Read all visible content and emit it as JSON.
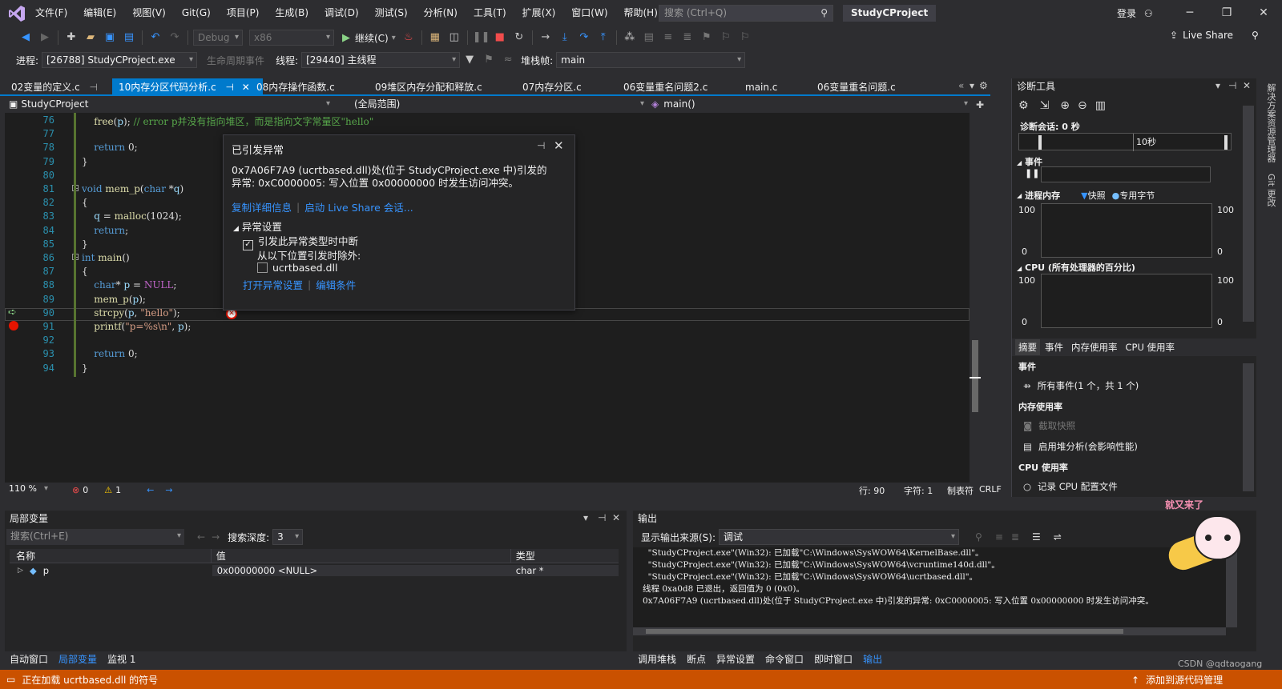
{
  "menu": [
    "文件(F)",
    "编辑(E)",
    "视图(V)",
    "Git(G)",
    "项目(P)",
    "生成(B)",
    "调试(D)",
    "测试(S)",
    "分析(N)",
    "工具(T)",
    "扩展(X)",
    "窗口(W)",
    "帮助(H)"
  ],
  "search_placeholder": "搜索 (Ctrl+Q)",
  "solution_name": "StudyCProject",
  "signin": "登录",
  "live_share": "Live Share",
  "toolbar": {
    "config": "Debug",
    "platform": "x86",
    "continue": "继续(C)",
    "process_label": "进程:",
    "process_value": "[26788] StudyCProject.exe",
    "lifecycle": "生命周期事件",
    "thread_label": "线程:",
    "thread_value": "[29440] 主线程",
    "stack_label": "堆栈帧:",
    "stack_value": "main"
  },
  "tabs": [
    {
      "label": "02变量的定义.c",
      "active": false
    },
    {
      "label": "10内存分区代码分析.c",
      "active": true
    },
    {
      "label": "08内存操作函数.c",
      "active": false
    },
    {
      "label": "09堆区内存分配和释放.c",
      "active": false
    },
    {
      "label": "07内存分区.c",
      "active": false
    },
    {
      "label": "06变量重名问题2.c",
      "active": false
    },
    {
      "label": "main.c",
      "active": false
    },
    {
      "label": "06变量重名问题.c",
      "active": false
    }
  ],
  "navbar": {
    "project": "StudyCProject",
    "scope": "(全局范围)",
    "member": "main()"
  },
  "code_lines": [
    {
      "n": "76",
      "html": "    <span class='fn'>free</span>(<span class='var'>p</span>); <span class='cm'>// error p并没有指向堆区，而是指向文字常量区\"hello\"</span>"
    },
    {
      "n": "77",
      "html": ""
    },
    {
      "n": "78",
      "html": "    <span class='kw'>return</span> 0;"
    },
    {
      "n": "79",
      "html": "}"
    },
    {
      "n": "80",
      "html": ""
    },
    {
      "n": "81",
      "html": "<span class='kw'>void</span> <span class='fn'>mem_p</span>(<span class='kw'>char</span> *<span class='var'>q</span>)"
    },
    {
      "n": "82",
      "html": "{"
    },
    {
      "n": "83",
      "html": "    <span class='var'>q</span> = <span class='fn'>malloc</span>(1024);"
    },
    {
      "n": "84",
      "html": "    <span class='kw'>return</span>;"
    },
    {
      "n": "85",
      "html": "}"
    },
    {
      "n": "86",
      "html": "<span class='kw'>int</span> <span class='fn'>main</span>()"
    },
    {
      "n": "87",
      "html": "{"
    },
    {
      "n": "88",
      "html": "    <span class='kw'>char</span>* <span class='var'>p</span> = <span class='mac'>NULL</span>;"
    },
    {
      "n": "89",
      "html": "    <span class='fn'>mem_p</span>(<span class='var'>p</span>);"
    },
    {
      "n": "90",
      "html": "    <span class='fn'>strcpy</span>(<span class='var'>p</span>, <span class='str'>\"hello\"</span>);"
    },
    {
      "n": "91",
      "html": "    <span class='fn'>printf</span>(<span class='str'>\"p=%s\\n\"</span>, <span class='var'>p</span>);"
    },
    {
      "n": "92",
      "html": ""
    },
    {
      "n": "93",
      "html": "    <span class='kw'>return</span> 0;"
    },
    {
      "n": "94",
      "html": "}"
    }
  ],
  "exception": {
    "title": "已引发异常",
    "message1": "0x7A06F7A9 (ucrtbased.dll)处(位于 StudyCProject.exe 中)引发的",
    "message2": "异常: 0xC0000005: 写入位置 0x00000000 时发生访问冲突。",
    "copy_details": "复制详细信息",
    "start_live_share": "启动 Live Share 会话...",
    "settings_header": "异常设置",
    "break_when": "引发此异常类型时中断",
    "except_from": "从以下位置引发时除外:",
    "dll": "ucrtbased.dll",
    "open_settings": "打开异常设置",
    "edit_conditions": "编辑条件"
  },
  "editor_status": {
    "zoom": "110 %",
    "errors": "0",
    "warnings": "1",
    "line": "行: 90",
    "char": "字符: 1",
    "tabs": "制表符",
    "eol": "CRLF"
  },
  "diag": {
    "title": "诊断工具",
    "session": "诊断会话: 0 秒",
    "timeline_tick": "10秒",
    "events": "事件",
    "process_memory": "进程内存",
    "snapshot": "快照",
    "private_bytes": "专用字节",
    "mem_max": "100",
    "mem_min": "0",
    "cpu": "CPU (所有处理器的百分比)",
    "cpu_max": "100",
    "cpu_min": "0",
    "tabs": [
      "摘要",
      "事件",
      "内存使用率",
      "CPU 使用率"
    ],
    "events_header": "事件",
    "all_events": "所有事件(1 个，共 1 个)",
    "memory_header": "内存使用率",
    "take_snapshot": "截取快照",
    "heap_profiling": "启用堆分析(会影响性能)",
    "cpu_header": "CPU 使用率",
    "record_cpu": "记录 CPU 配置文件"
  },
  "locals": {
    "title": "局部变量",
    "search_placeholder": "搜索(Ctrl+E)",
    "depth_label": "搜索深度:",
    "depth_value": "3",
    "cols": [
      "名称",
      "值",
      "类型"
    ],
    "rows": [
      {
        "name": "p",
        "value": "0x00000000 <NULL>",
        "type": "char *"
      }
    ]
  },
  "output": {
    "title": "输出",
    "source_label": "显示输出来源(S):",
    "source_value": "调试",
    "lines": [
      "  \"StudyCProject.exe\"(Win32): 已加载\"C:\\Windows\\SysWOW64\\KernelBase.dll\"。",
      "  \"StudyCProject.exe\"(Win32): 已加载\"C:\\Windows\\SysWOW64\\vcruntime140d.dll\"。",
      "  \"StudyCProject.exe\"(Win32): 已加载\"C:\\Windows\\SysWOW64\\ucrtbased.dll\"。",
      "线程 0xa0d8 已退出，返回值为 0 (0x0)。",
      "0x7A06F7A9 (ucrtbased.dll)处(位于 StudyCProject.exe 中)引发的异常: 0xC0000005: 写入位置 0x00000000 时发生访问冲突。"
    ]
  },
  "bottom_tabs_left": [
    "自动窗口",
    "局部变量",
    "监视 1"
  ],
  "bottom_tabs_right": [
    "调用堆栈",
    "断点",
    "异常设置",
    "命令窗口",
    "即时窗口",
    "输出"
  ],
  "status": {
    "loading": "正在加载 ucrtbased.dll 的符号",
    "add_source": "添加到源代码管理",
    "watermark": "CSDN @qdtaogang"
  },
  "right_strip": [
    "解决方案资源管理器",
    "Git 更改"
  ],
  "mascot_text": "就又来了"
}
